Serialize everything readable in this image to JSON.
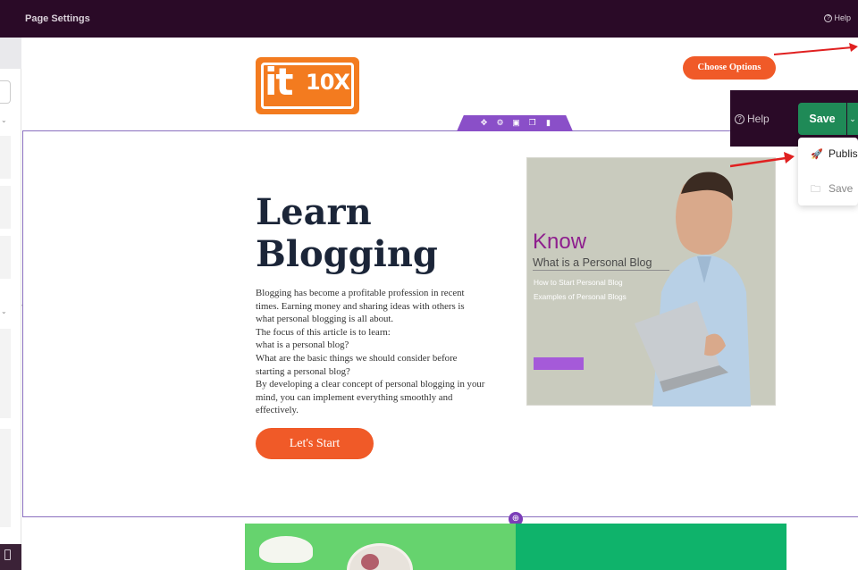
{
  "topbar": {
    "title": "Page Settings",
    "help": "Help"
  },
  "header": {
    "logo": {
      "it": "it",
      "ten": "10X"
    },
    "choose_options": "Choose Options"
  },
  "hero": {
    "heading_line1": "Learn",
    "heading_line2": "Blogging",
    "paragraph": [
      "Blogging has become a profitable profession in recent",
      "times. Earning money and sharing ideas with others is",
      "what personal blogging is all about.",
      "The focus of this article is to learn:",
      "what is a personal blog?",
      "What are the basic things we should consider before",
      "starting a personal blog?",
      "By developing a clear concept of personal blogging in your",
      "mind, you can implement everything smoothly and",
      "effectively."
    ],
    "cta": "Let's Start",
    "image": {
      "know": "Know",
      "what": "What is a Personal Blog",
      "sub1": "How to Start Personal Blog",
      "sub2": "Examples of Personal Blogs"
    }
  },
  "publish_panel": {
    "help": "Help",
    "save": "Save",
    "caret": "⌄",
    "options": [
      "Publis",
      "Save"
    ]
  },
  "colors": {
    "topbar": "#2a0a27",
    "accent_orange": "#f05a28",
    "save_green": "#1f8a57",
    "section_purple": "#8a4fc8"
  },
  "icons": {
    "section_tools": [
      "move-icon",
      "settings-icon",
      "save-icon",
      "duplicate-icon",
      "delete-icon"
    ],
    "add": "plus-circle-icon"
  }
}
